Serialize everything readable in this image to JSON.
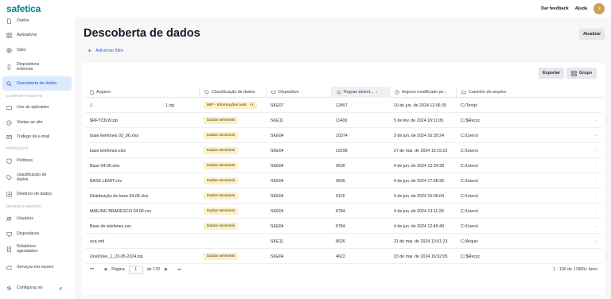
{
  "header": {
    "logo": "safetica",
    "feedback": "Dar feedback",
    "help": "Ajuda",
    "avatar_letter": "s"
  },
  "sidebar": {
    "items": [
      {
        "label": "Dados",
        "icon": "data-icon"
      },
      {
        "label": "Aplicativos",
        "icon": "apps-icon"
      },
      {
        "label": "Sites",
        "icon": "globe-icon"
      },
      {
        "label": "Dispositivos externos",
        "icon": "usb-icon"
      },
      {
        "label": "Descoberta de dados",
        "icon": "search-icon",
        "active": true
      }
    ],
    "section_comportamento": "COMPORTAMENTO",
    "comportamento_items": [
      {
        "label": "Uso do aplicativo",
        "icon": "app-usage-icon"
      },
      {
        "label": "Visitas ao site",
        "icon": "site-visit-icon"
      },
      {
        "label": "Tráfego de e-mail",
        "icon": "mail-icon"
      }
    ],
    "section_protecao": "PROTEÇÃO",
    "protecao_items": [
      {
        "label": "Políticas",
        "icon": "shield-icon"
      },
      {
        "label": "classificação de dados",
        "icon": "tag-icon"
      },
      {
        "label": "Destinos de dados",
        "icon": "destination-icon"
      }
    ],
    "section_gerenciamento": "GERENCIAMENTO",
    "gerenciamento_items": [
      {
        "label": "Usuários",
        "icon": "users-icon"
      },
      {
        "label": "Dispositivos",
        "icon": "devices-icon"
      },
      {
        "label": "Relatórios agendados",
        "icon": "report-icon"
      },
      {
        "label": "Serviços em nuvem",
        "icon": "cloud-icon"
      }
    ],
    "settings": "Configuraç es",
    "collapse_icon": "collapse-icon"
  },
  "main": {
    "title": "Descoberta de dados",
    "refresh": "Atualizar",
    "add_filter": "Adicionar filtro",
    "export": "Exportar",
    "group": "Grupo"
  },
  "table": {
    "columns": [
      "Arquivo",
      "Classificação de dados",
      "Dispositivo",
      "Regras detect...",
      "Arquivo modificado pe...",
      "Caminho do arquivo"
    ],
    "rows": [
      {
        "file_a": "J",
        "file_b": "1.zip",
        "badge": "MIP - Informações resti",
        "badge_extra": "+1",
        "device": "SKE07",
        "rules": "12457",
        "modified": "10 de jun. de 2024 12:06:39",
        "path": "C:/Temp/"
      },
      {
        "file_a": "$RFY23LW.zip",
        "file_b": "",
        "badge": "Dados sensíveis",
        "badge_extra": "",
        "device": "SKE11",
        "rules": "11400",
        "modified": "5 de fev. de 2024 18:11:05",
        "path": "C:/$Recyc"
      },
      {
        "file_a": "base telefones 03_06.xlsx",
        "file_b": "",
        "badge": "Dados sensíveis",
        "badge_extra": "",
        "device": "SKE04",
        "rules": "10374",
        "modified": "3 de jun. de 2024 16:39:24",
        "path": "C:/Users/"
      },
      {
        "file_a": "base telefones.xlsx",
        "file_b": "",
        "badge": "Dados sensíveis",
        "badge_extra": "",
        "device": "SKE04",
        "rules": "10298",
        "modified": "27 de mai. de 2024 15:15:22",
        "path": "C:/Users/"
      },
      {
        "file_a": "Base 04.06.xlsx",
        "file_b": "",
        "badge": "Dados sensíveis",
        "badge_extra": "",
        "device": "SKE04",
        "rules": "9536",
        "modified": "4 de jun. de 2024 12:34:38",
        "path": "C:/Users/"
      },
      {
        "file_a": "BASE LEMIT.csv",
        "file_b": "",
        "badge": "Dados sensíveis",
        "badge_extra": "",
        "device": "SKE04",
        "rules": "9536",
        "modified": "4 de jun. de 2024 17:58:36",
        "path": "C:/Users/"
      },
      {
        "file_a": "Distribuição de base 04.06.xlsx",
        "file_b": "",
        "badge": "Dados sensíveis",
        "badge_extra": "",
        "device": "SKE04",
        "rules": "9118",
        "modified": "4 de jun. de 2024 15:06:04",
        "path": "C:/Users/"
      },
      {
        "file_a": "MAILING BRADESCO 04.06.csv",
        "file_b": "",
        "badge": "Dados sensíveis",
        "badge_extra": "",
        "device": "SKE04",
        "rules": "8784",
        "modified": "4 de jun. de 2024 13:11:28",
        "path": "C:/Users/"
      },
      {
        "file_a": "Base de telefones.csv",
        "file_b": "",
        "badge": "Dados sensíveis",
        "badge_extra": "",
        "device": "SKE04",
        "rules": "8784",
        "modified": "4 de jun. de 2024 12:45:49",
        "path": "C:/Users/"
      },
      {
        "file_a": "eca.xml",
        "file_b": "",
        "badge": "",
        "badge_extra": "",
        "device": "SKE11",
        "rules": "8026",
        "modified": "31 de mai. de 2024 13:01:23",
        "path": "C:/Arquiv"
      },
      {
        "file_a": "OneDrive_1_23-05-2024.zip",
        "file_b": "",
        "badge": "Dados sensíveis",
        "badge_extra": "",
        "device": "SKE04",
        "rules": "4622",
        "modified": "23 de mai. de 2024 16:02:05",
        "path": "C:/$Recyc"
      }
    ]
  },
  "pager": {
    "page_label": "Página",
    "page_value": "1",
    "of_label": "de 178",
    "range": "1 - 100 de 17800+ itens"
  }
}
